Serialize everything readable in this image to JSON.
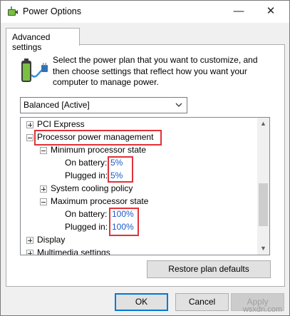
{
  "window": {
    "title": "Power Options",
    "minimize_glyph": "—",
    "close_glyph": "✕"
  },
  "tab": {
    "label": "Advanced settings"
  },
  "description": "Select the power plan that you want to customize, and then choose settings that reflect how you want your computer to manage power.",
  "plan_select": {
    "value": "Balanced [Active]"
  },
  "tree": {
    "pci_express": "PCI Express",
    "processor_power_management": "Processor power management",
    "minimum_processor_state": "Minimum processor state",
    "min_on_battery_label": "On battery:",
    "min_on_battery_value": "5%",
    "min_plugged_in_label": "Plugged in:",
    "min_plugged_in_value": "5%",
    "system_cooling_policy": "System cooling policy",
    "maximum_processor_state": "Maximum processor state",
    "max_on_battery_label": "On battery:",
    "max_on_battery_value": "100%",
    "max_plugged_in_label": "Plugged in:",
    "max_plugged_in_value": "100%",
    "display": "Display",
    "multimedia_settings": "Multimedia settings"
  },
  "buttons": {
    "restore_defaults": "Restore plan defaults",
    "ok": "OK",
    "cancel": "Cancel",
    "apply": "Apply"
  },
  "watermark": "wsxdn.com",
  "colors": {
    "highlight_box": "#e03238",
    "link_value": "#1a5cc7",
    "focus_blue": "#0078d7"
  },
  "icons": [
    "power-options-app-icon",
    "battery-plug-icon",
    "chevron-down-icon",
    "expand-icon",
    "collapse-icon",
    "scroll-up-icon",
    "scroll-down-icon"
  ]
}
